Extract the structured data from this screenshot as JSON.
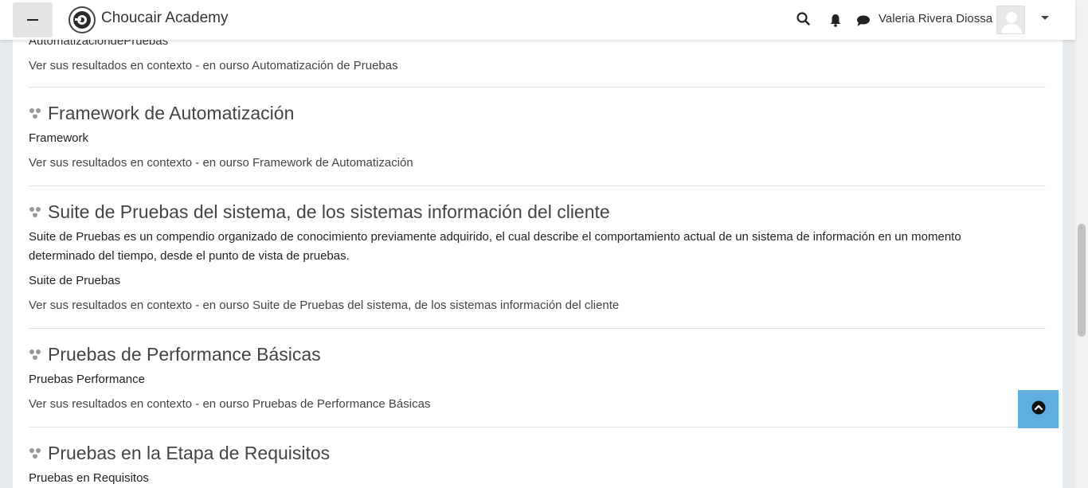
{
  "navbar": {
    "brand": "Choucair Academy",
    "user_name": "Valeria Rivera Diossa",
    "icons": [
      "menu-icon",
      "search-icon",
      "bell-icon",
      "chat-icon",
      "chevron-down-icon"
    ]
  },
  "results": [
    {
      "partial_text": "AutomatizaciondePruebas",
      "context": "Ver sus resultados en contexto - en ourso Automatización de Pruebas"
    },
    {
      "title": "Framework de Automatización",
      "lines": [
        "Framework"
      ],
      "context": "Ver sus resultados en contexto - en ourso Framework de Automatización"
    },
    {
      "title": "Suite de Pruebas del sistema, de los sistemas información del cliente",
      "lines": [
        "Suite de Pruebas es un compendio organizado de conocimiento previamente adquirido, el cual describe el comportamiento actual de un sistema de información en un momento",
        "determinado del tiempo, desde el punto de vista de pruebas.",
        "Suite de Pruebas"
      ],
      "context": "Ver sus resultados en contexto - en ourso Suite de Pruebas del sistema, de los sistemas información del cliente"
    },
    {
      "title": "Pruebas de Performance Básicas",
      "lines": [
        "Pruebas Performance"
      ],
      "context": "Ver sus resultados en contexto - en ourso Pruebas de Performance Básicas"
    },
    {
      "title": "Pruebas en la Etapa de Requisitos",
      "lines": [
        "Pruebas en Requisitos"
      ]
    }
  ],
  "back_to_top_icon": "arrow-up-circle-icon",
  "colors": {
    "accent": "#5fb0de",
    "navbar_bg": "#ffffff",
    "page_bg": "#e9ecef"
  }
}
